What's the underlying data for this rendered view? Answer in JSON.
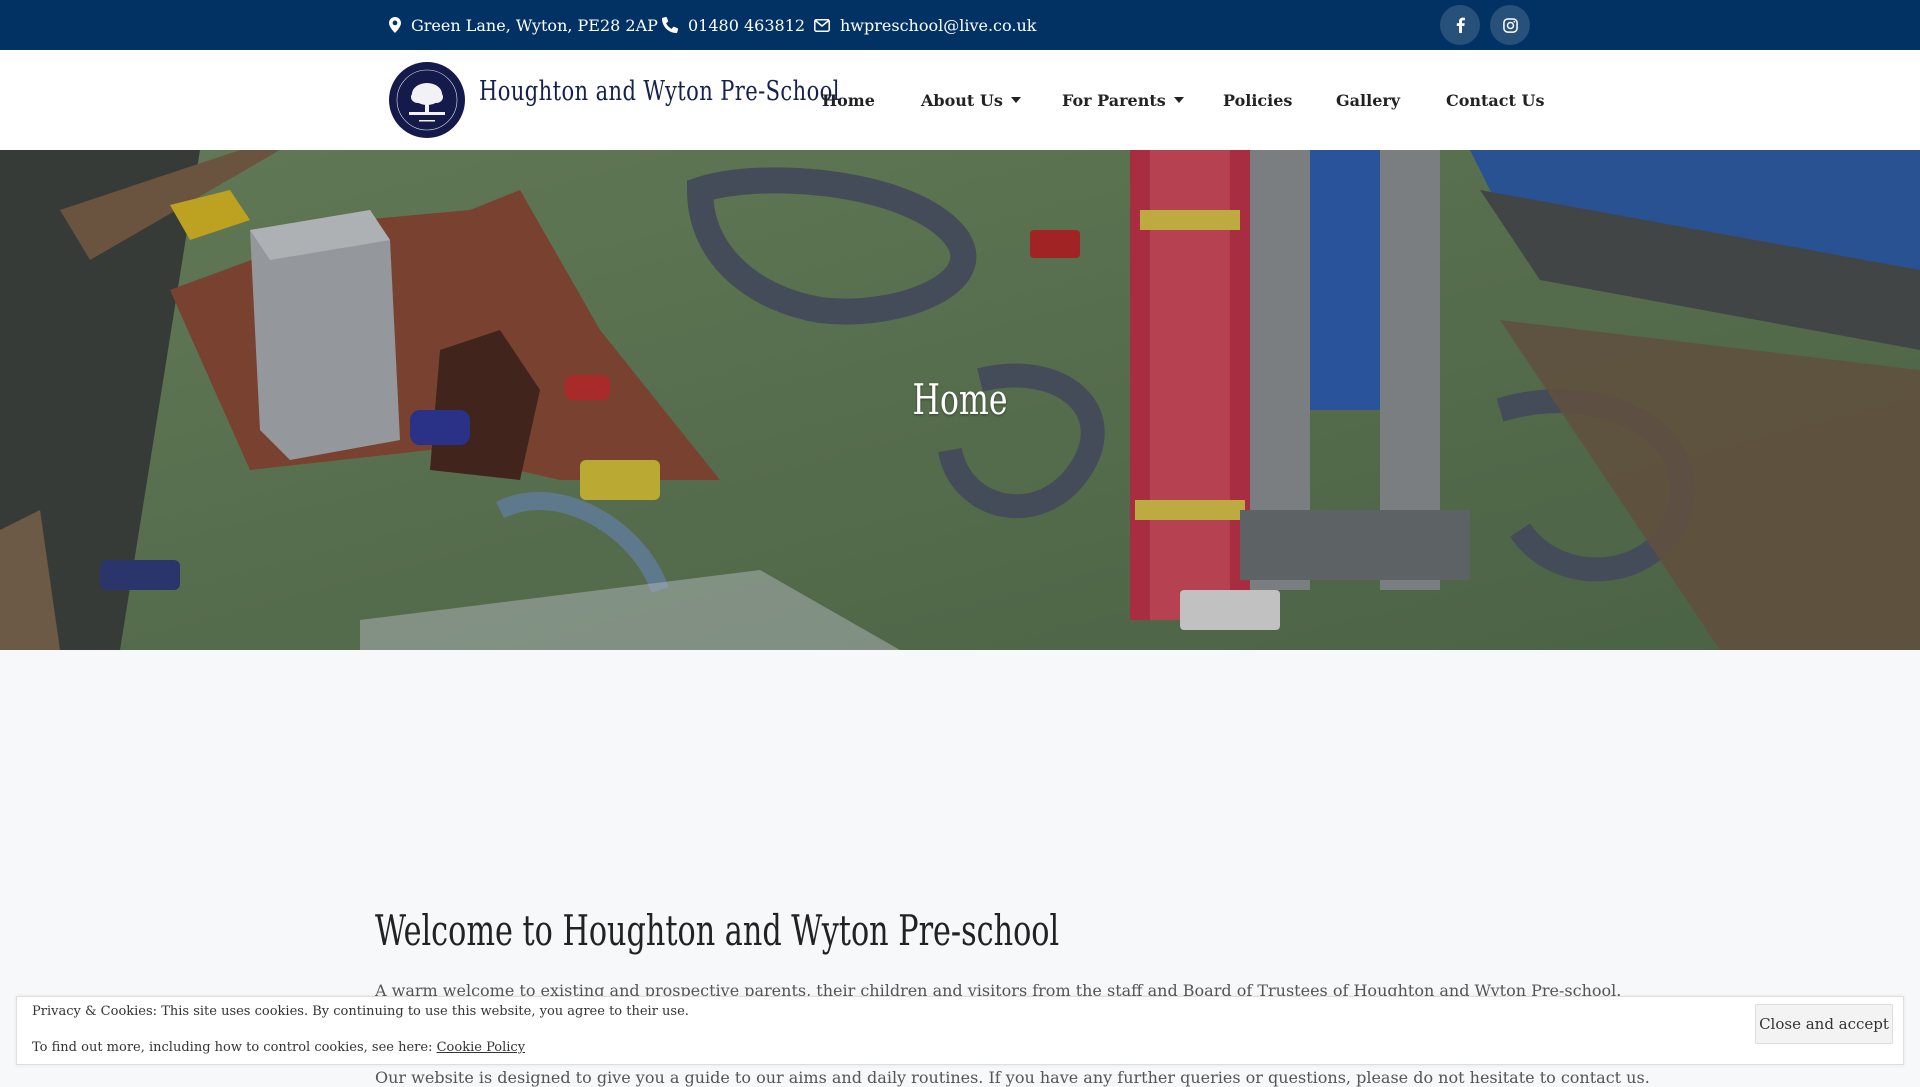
{
  "topbar": {
    "address": "Green Lane, Wyton, PE28 2AP",
    "phone": "01480 463812",
    "email": "hwpreschool@live.co.uk",
    "background_color": "#023263"
  },
  "header": {
    "site_title": "Houghton and Wyton Pre-School",
    "nav": [
      {
        "label": "Home"
      },
      {
        "label": "About Us"
      },
      {
        "label": "For Parents"
      },
      {
        "label": "Policies"
      },
      {
        "label": "Gallery"
      },
      {
        "label": "Contact Us"
      }
    ]
  },
  "hero": {
    "title": "Home"
  },
  "main": {
    "heading": "Welcome to Houghton and Wyton Pre-school",
    "paragraph_1": "A warm welcome to existing and prospective parents, their children and visitors from the staff and Board of Trustees of Houghton and Wyton Pre-school.",
    "paragraph_2": "Our website is designed to give you a guide to our aims and daily routines. If you have any further queries or questions, please do not hesitate to contact us."
  },
  "cookie_banner": {
    "line_1": "Privacy & Cookies: This site uses cookies. By continuing to use this website, you agree to their use.",
    "line_2_prefix": "To find out more, including how to control cookies, see here:",
    "link_label": "Cookie Policy",
    "button_label": "Close and accept"
  }
}
